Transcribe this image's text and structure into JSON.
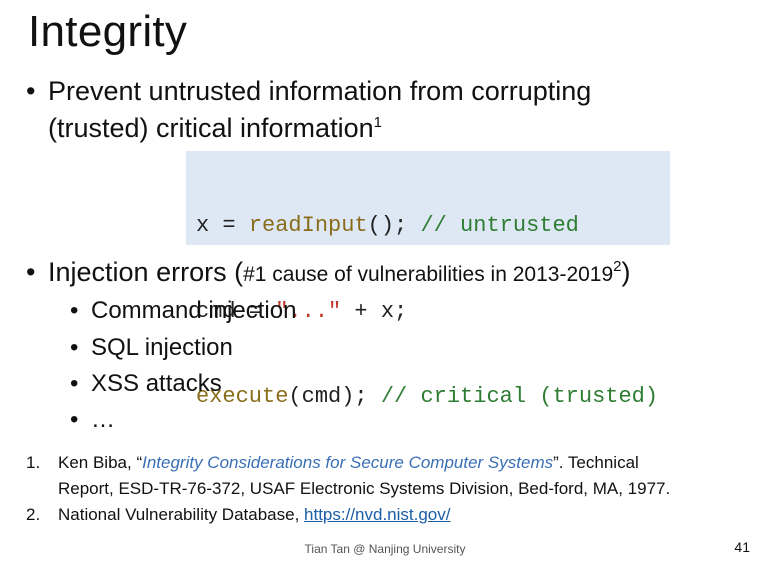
{
  "slide": {
    "title": "Integrity",
    "bullet1": {
      "marker": "•",
      "line1": "Prevent untrusted information from corrupting",
      "line2": "(trusted) critical information",
      "sup": "1"
    },
    "code": {
      "line1": {
        "p1": "x = ",
        "func": "readInput",
        "p2": "(); ",
        "comment": "// untrusted"
      },
      "line2": {
        "p1": "cmd = ",
        "string": "\"...\"",
        "p2": " + x;"
      },
      "line3": {
        "func": "execute",
        "p1": "(cmd); ",
        "comment": "// critical (trusted)"
      }
    },
    "bullet2": {
      "marker": "•",
      "main": "Injection errors (",
      "small": "#1 cause of vulnerabilities in 2013-2019",
      "sup": "2",
      "close": ")"
    },
    "sub_bullets": {
      "marker": "•",
      "items": [
        "Command injection",
        "SQL injection",
        "XSS attacks",
        "…"
      ]
    },
    "references": {
      "ref1": {
        "num": "1.",
        "author": "Ken Biba, “",
        "title": "Integrity Considerations for Secure Computer Systems",
        "rest_line1": "”. Technical",
        "line2": "Report, ESD-TR-76-372, USAF Electronic Systems Division, Bed-ford, MA, 1977."
      },
      "ref2": {
        "num": "2.",
        "text": "National Vulnerability Database, ",
        "url": "https://nvd.nist.gov/"
      }
    },
    "footer": "Tian Tan @ Nanjing University",
    "page_number": "41"
  }
}
